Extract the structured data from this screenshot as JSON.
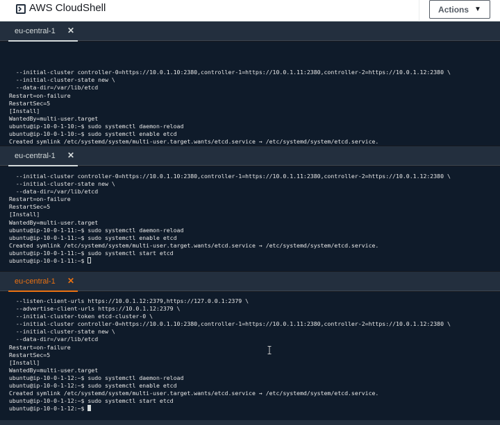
{
  "header": {
    "title": "AWS CloudShell",
    "actions_label": "Actions",
    "actions_caret": "▼",
    "icon": "terminal-prompt-icon"
  },
  "panes": [
    {
      "tab_label": "eu-central-1",
      "tab_close": "✕",
      "active": false,
      "lines": [
        "  --initial-cluster controller-0=https://10.0.1.10:2380,controller-1=https://10.0.1.11:2380,controller-2=https://10.0.1.12:2380 \\",
        "  --initial-cluster-state new \\",
        "  --data-dir=/var/lib/etcd",
        "Restart=on-failure",
        "RestartSec=5",
        "[Install]",
        "WantedBy=multi-user.target",
        "ubuntu@ip-10-0-1-10:~$ sudo systemctl daemon-reload",
        "ubuntu@ip-10-0-1-10:~$ sudo systemctl enable etcd",
        "Created symlink /etc/systemd/system/multi-user.target.wants/etcd.service → /etc/systemd/system/etcd.service.",
        "ubuntu@ip-10-0-1-10:~$ sudo systemctl start etcd",
        "ubuntu@ip-10-0-1-10:~$ "
      ]
    },
    {
      "tab_label": "eu-central-1",
      "tab_close": "✕",
      "active": false,
      "lines": [
        "  --initial-cluster controller-0=https://10.0.1.10:2380,controller-1=https://10.0.1.11:2380,controller-2=https://10.0.1.12:2380 \\",
        "  --initial-cluster-state new \\",
        "  --data-dir=/var/lib/etcd",
        "Restart=on-failure",
        "RestartSec=5",
        "[Install]",
        "WantedBy=multi-user.target",
        "ubuntu@ip-10-0-1-11:~$ sudo systemctl daemon-reload",
        "ubuntu@ip-10-0-1-11:~$ sudo systemctl enable etcd",
        "Created symlink /etc/systemd/system/multi-user.target.wants/etcd.service → /etc/systemd/system/etcd.service.",
        "ubuntu@ip-10-0-1-11:~$ sudo systemctl start etcd",
        "ubuntu@ip-10-0-1-11:~$ "
      ]
    },
    {
      "tab_label": "eu-central-1",
      "tab_close": "✕",
      "active": true,
      "lines": [
        "  --listen-client-urls https://10.0.1.12:2379,https://127.0.0.1:2379 \\",
        "  --advertise-client-urls https://10.0.1.12:2379 \\",
        "  --initial-cluster-token etcd-cluster-0 \\",
        "  --initial-cluster controller-0=https://10.0.1.10:2380,controller-1=https://10.0.1.11:2380,controller-2=https://10.0.1.12:2380 \\",
        "  --initial-cluster-state new \\",
        "  --data-dir=/var/lib/etcd",
        "Restart=on-failure",
        "RestartSec=5",
        "[Install]",
        "WantedBy=multi-user.target",
        "ubuntu@ip-10-0-1-12:~$ sudo systemctl daemon-reload",
        "ubuntu@ip-10-0-1-12:~$ sudo systemctl enable etcd",
        "Created symlink /etc/systemd/system/multi-user.target.wants/etcd.service → /etc/systemd/system/etcd.service.",
        "ubuntu@ip-10-0-1-12:~$ sudo systemctl start etcd",
        "ubuntu@ip-10-0-1-12:~$ "
      ]
    }
  ],
  "colors": {
    "active_tab": "#ec7211",
    "terminal_bg": "#0f1b2a",
    "tabbar_bg": "#232f3e"
  }
}
